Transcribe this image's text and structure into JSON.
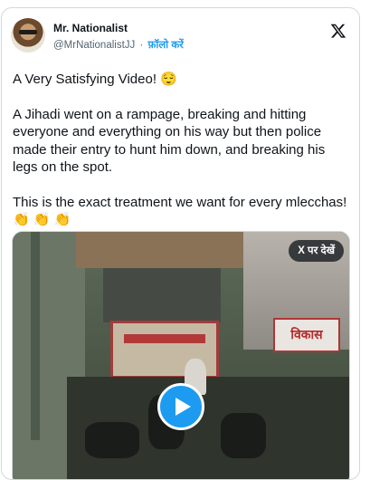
{
  "author": {
    "name": "Mr. Nationalist",
    "handle": "@MrNationalistJJ",
    "separator": "·",
    "follow_label": "फ़ॉलो करें"
  },
  "tweet": {
    "line1": "A Very Satisfying Video!",
    "line1_emoji": "😌",
    "line2": "A Jihadi went on a rampage, breaking and hitting everyone and everything on his way but then police made their entry to hunt him down, and breaking his legs on the spot.",
    "line3": "This is the exact treatment we want for every mlecchas!",
    "line3_emojis": "👏 👏 👏"
  },
  "media": {
    "view_on_x_label": "X पर देखें",
    "shop_sign_text": "विकास"
  },
  "icons": {
    "x_logo": "x-logo-icon",
    "play": "play-icon"
  },
  "colors": {
    "accent": "#1d9bf0",
    "text": "#0f1419",
    "muted": "#536471"
  }
}
